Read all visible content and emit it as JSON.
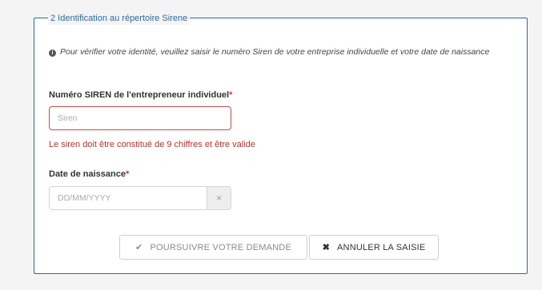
{
  "section": {
    "legend": "2 Identification au répertoire Sirene",
    "info": "Pour vérifier votre identité, veuillez saisir le numéro Siren de votre entreprise individuelle et votre date de naissance",
    "info_icon": "info-circle-icon"
  },
  "siren": {
    "label": "Numéro SIREN de l'entrepreneur individuel",
    "required_mark": "*",
    "placeholder": "Siren",
    "value": "",
    "error": "Le siren doit être constitué de 9 chiffres et être valide"
  },
  "birthdate": {
    "label": "Date de naissance",
    "required_mark": "*",
    "placeholder": "DD/MM/YYYY",
    "value": "",
    "clear_icon": "close-icon"
  },
  "actions": {
    "submit_label": "POURSUIVRE VOTRE DEMANDE",
    "submit_icon": "check-icon",
    "cancel_label": "ANNULER LA SAISIE",
    "cancel_icon": "close-icon"
  },
  "colors": {
    "accent": "#2b6aa3",
    "error": "#b8322e",
    "error_border": "#c74c4c"
  }
}
